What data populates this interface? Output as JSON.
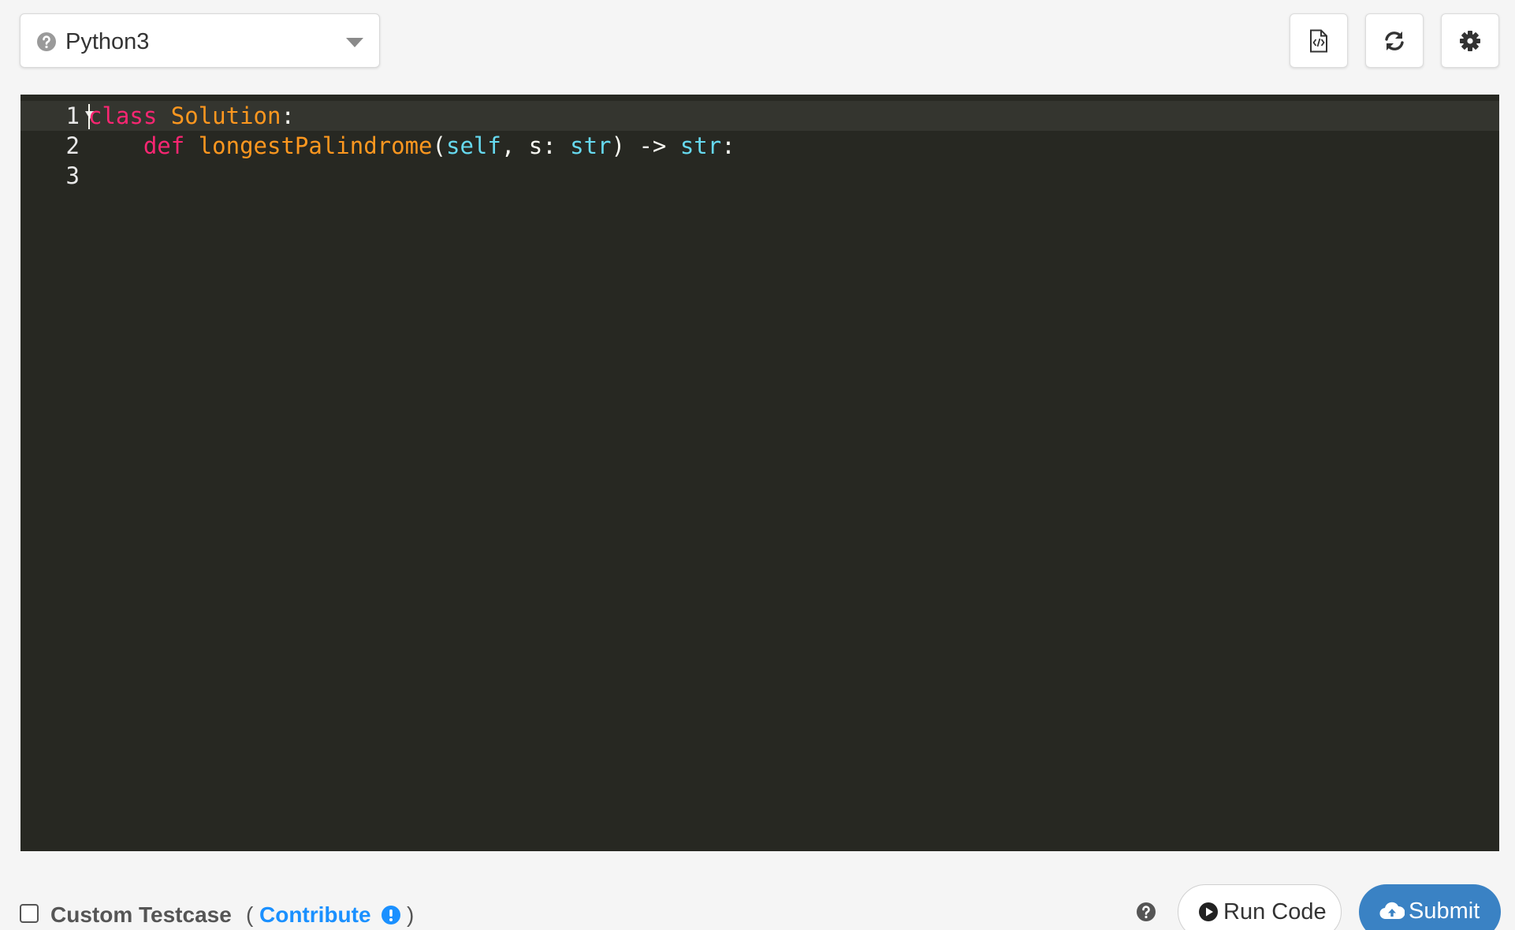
{
  "toolbar": {
    "language": {
      "selected": "Python3",
      "icon": "help-circle-icon",
      "caret_icon": "caret-down-icon"
    },
    "buttons": [
      {
        "name": "code-file-button",
        "icon": "code-file-icon"
      },
      {
        "name": "reset-code-button",
        "icon": "refresh-icon"
      },
      {
        "name": "settings-button",
        "icon": "gear-icon"
      }
    ]
  },
  "editor": {
    "theme": {
      "background": "#272822",
      "active_line": "#34352f",
      "keyword": "#f92672",
      "class_name": "#fd971f",
      "function_name": "#fd971f",
      "builtin": "#66d9ef",
      "text": "#f8f8f2"
    },
    "line_numbers": [
      "1",
      "2",
      "3"
    ],
    "lines": [
      {
        "tokens": [
          {
            "type": "kw",
            "text": "class"
          },
          {
            "type": "plain",
            "text": " "
          },
          {
            "type": "cls",
            "text": "Solution"
          },
          {
            "type": "plain",
            "text": ":"
          }
        ]
      },
      {
        "tokens": [
          {
            "type": "plain",
            "text": "    "
          },
          {
            "type": "kw",
            "text": "def"
          },
          {
            "type": "plain",
            "text": " "
          },
          {
            "type": "fn",
            "text": "longestPalindrome"
          },
          {
            "type": "plain",
            "text": "("
          },
          {
            "type": "self",
            "text": "self"
          },
          {
            "type": "plain",
            "text": ", s: "
          },
          {
            "type": "type",
            "text": "str"
          },
          {
            "type": "plain",
            "text": ") -> "
          },
          {
            "type": "type",
            "text": "str"
          },
          {
            "type": "plain",
            "text": ":"
          }
        ]
      },
      {
        "tokens": []
      }
    ]
  },
  "footer": {
    "custom_testcase_label": "Custom Testcase",
    "paren_open": "(",
    "contribute_label": "Contribute",
    "paren_close": ")",
    "run_code_label": "Run Code",
    "submit_label": "Submit",
    "submit_color": "#3a82c4",
    "link_color": "#1a90ff"
  }
}
